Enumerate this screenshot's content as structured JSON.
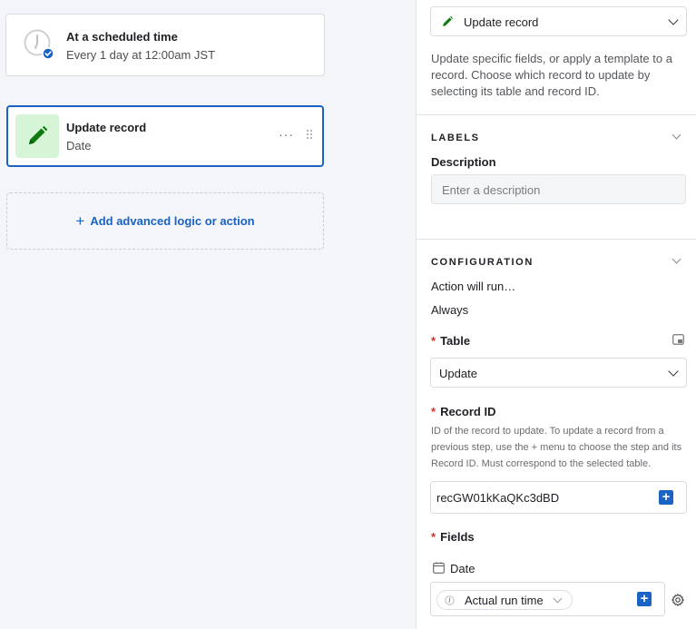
{
  "canvas": {
    "trigger": {
      "title": "At a scheduled time",
      "subtitle": "Every 1 day at 12:00am JST"
    },
    "action": {
      "title": "Update record",
      "subtitle": "Date",
      "more": "···"
    },
    "add_logic_label": "Add advanced logic or action",
    "add_logic_plus": "+"
  },
  "panel": {
    "action_type": "Update record",
    "description": "Update specific fields, or apply a template to a record. Choose which record to update by selecting its table and record ID.",
    "labels_section": {
      "header": "LABELS",
      "description_label": "Description",
      "description_placeholder": "Enter a description"
    },
    "config_section": {
      "header": "CONFIGURATION",
      "action_will_run_label": "Action will run…",
      "action_will_run_value": "Always",
      "required_marker": "*",
      "table_label": "Table",
      "table_value": "Update",
      "record_id_label": "Record ID",
      "record_id_help": "ID of the record to update. To update a record from a previous step, use the + menu to choose the step and its Record ID. Must correspond to the selected table.",
      "record_id_value": "recGW01kKaQKc3dBD",
      "fields_label": "Fields",
      "field_name": "Date",
      "field_value": "Actual run time",
      "plus": "+"
    }
  },
  "colors": {
    "accent_blue": "#1a62c4",
    "pencil_green": "#0f7a0f",
    "pencil_bg": "#d6f5d6",
    "required_red": "#d0302c"
  }
}
